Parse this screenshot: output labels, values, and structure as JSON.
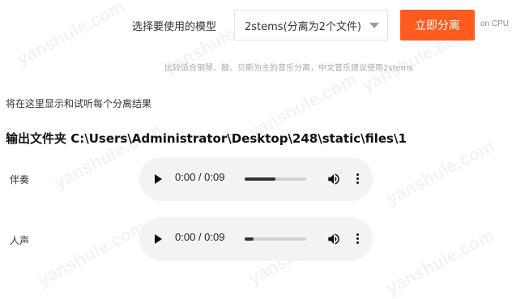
{
  "controls": {
    "model_label": "选择要使用的模型",
    "model_selected": "2stems(分离为2个文件)",
    "separate_button": "立即分离",
    "cpu_note": "on CPU",
    "hint": "比较适合钢琴、鼓、贝斯为主的音乐分离，中文音乐建议使用2stems"
  },
  "results": {
    "note": "将在这里显示和试听每个分离结果",
    "output_heading": "输出文件夹 C:\\Users\\Administrator\\Desktop\\248\\static\\files\\1",
    "tracks": [
      {
        "label": "伴奏",
        "time": "0:00 / 0:09",
        "progress": 0.5
      },
      {
        "label": "人声",
        "time": "0:00 / 0:09",
        "progress": 0.15
      }
    ]
  },
  "watermark_text": "yanshule.com",
  "colors": {
    "accent": "#ff5a1f",
    "player_bg": "#f1f3f4"
  }
}
